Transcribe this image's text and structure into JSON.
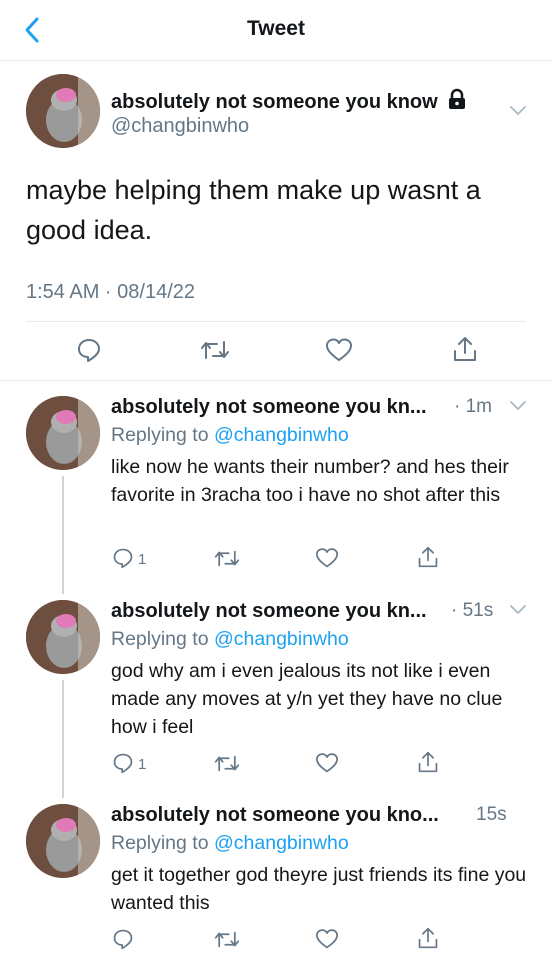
{
  "header": {
    "title": "Tweet"
  },
  "main": {
    "name": "absolutely not someone you know",
    "handle": "@changbinwho",
    "text": "maybe helping them make up wasnt a good idea.",
    "timestamp": "1:54 AM · 08/14/22"
  },
  "replies": [
    {
      "name": "absolutely not someone you kn...",
      "time": "· 1m",
      "replying_prefix": "Replying to",
      "replying_handle": "@changbinwho",
      "text": "like now he wants their number? and hes their favorite in 3racha too i have no shot after this",
      "reply_count": "1"
    },
    {
      "name": "absolutely not someone you kn...",
      "time": "· 51s",
      "replying_prefix": "Replying to",
      "replying_handle": "@changbinwho",
      "text": "god why am i even jealous its not like i even made any moves at y/n yet they have no clue how i feel",
      "reply_count": "1"
    },
    {
      "name": "absolutely not someone you kno...",
      "time": "15s",
      "replying_prefix": "Replying to",
      "replying_handle": "@changbinwho",
      "text": "get it together god theyre just friends its fine you wanted this",
      "reply_count": ""
    }
  ],
  "colors": {
    "accent": "#1da1f2",
    "muted": "#657786",
    "divider": "#e6ecf0"
  }
}
